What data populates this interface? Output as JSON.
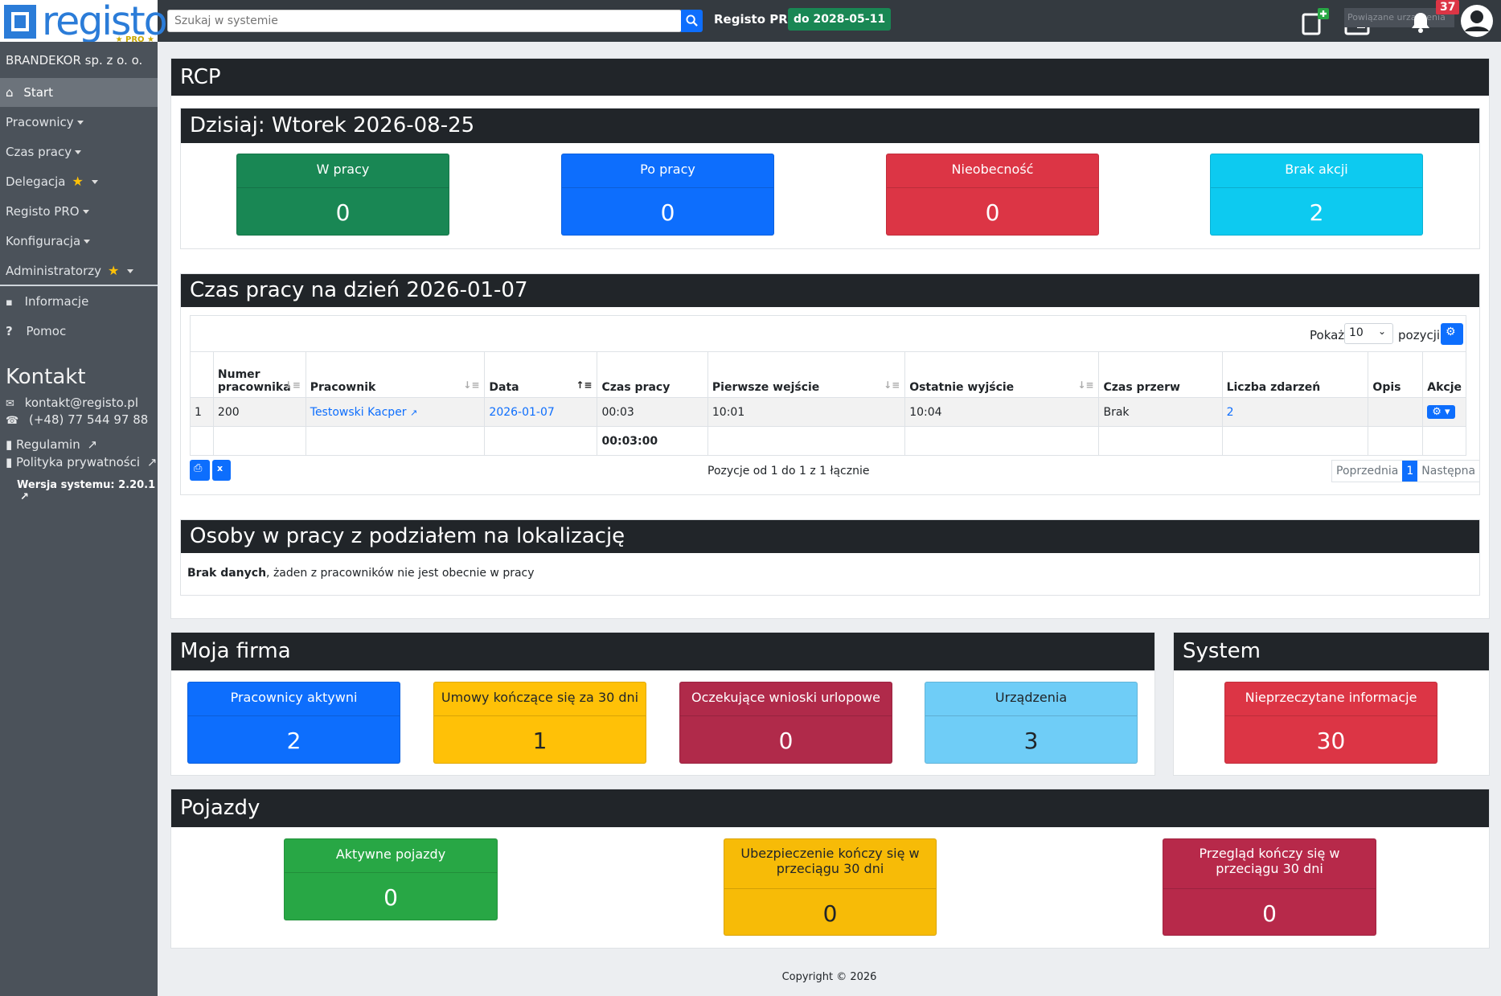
{
  "header": {
    "logo_text": "registo",
    "logo_pro": "★ PRO ★",
    "search_placeholder": "Szukaj w systemie",
    "pro_label": "Registo PRO",
    "pro_badge": "do 2028-05-11",
    "linked_devices_label": "Powiązane urządzenia",
    "notification_count": "37"
  },
  "sidebar": {
    "company": "BRANDEKOR sp. z o. o.",
    "items": [
      {
        "label": "Start"
      },
      {
        "label": "Pracownicy"
      },
      {
        "label": "Czas pracy"
      },
      {
        "label": "Delegacja"
      },
      {
        "label": "Registo PRO"
      },
      {
        "label": "Konfiguracja"
      },
      {
        "label": "Administratorzy"
      },
      {
        "label": "Informacje"
      },
      {
        "label": "Pomoc"
      }
    ],
    "kontakt_title": "Kontakt",
    "email": "kontakt@registo.pl",
    "phone": "(+48) 77 544 97 88",
    "regulamin": "Regulamin",
    "privacy": "Polityka prywatności",
    "version": "Wersja systemu: 2.20.1"
  },
  "rcp": {
    "title": "RCP",
    "today": {
      "title": "Dzisiaj: Wtorek 2026-08-25",
      "cards": [
        {
          "label": "W pracy",
          "value": "0"
        },
        {
          "label": "Po pracy",
          "value": "0"
        },
        {
          "label": "Nieobecność",
          "value": "0"
        },
        {
          "label": "Brak akcji",
          "value": "2"
        }
      ]
    },
    "worktime": {
      "title": "Czas pracy na dzień 2026-01-07",
      "show_label": "Pokaż",
      "show_value": "10",
      "show_suffix": "pozycji",
      "columns": [
        "",
        "Numer pracownika",
        "Pracownik",
        "Data",
        "Czas pracy",
        "Pierwsze wejście",
        "Ostatnie wyjście",
        "Czas przerw",
        "Liczba zdarzeń",
        "Opis",
        "Akcje"
      ],
      "rows": [
        {
          "lp": "1",
          "number": "200",
          "employee": "Testowski Kacper",
          "date": "2026-01-07",
          "time": "00:03",
          "first_in": "10:01",
          "last_out": "10:04",
          "breaks": "Brak",
          "events": "2",
          "desc": ""
        }
      ],
      "total": "00:03:00",
      "info": "Pozycje od 1 do 1 z 1 łącznie",
      "prev": "Poprzednia",
      "page": "1",
      "next": "Następna"
    },
    "locations": {
      "title": "Osoby w pracy z podziałem na lokalizację",
      "empty_bold": "Brak danych",
      "empty_text": ", żaden z pracowników nie jest obecnie w pracy"
    }
  },
  "firm": {
    "title": "Moja firma",
    "cards": [
      {
        "label": "Pracownicy aktywni",
        "value": "2"
      },
      {
        "label": "Umowy kończące się za 30 dni",
        "value": "1"
      },
      {
        "label": "Oczekujące wnioski urlopowe",
        "value": "0"
      },
      {
        "label": "Urządzenia",
        "value": "3"
      }
    ]
  },
  "system": {
    "title": "System",
    "cards": [
      {
        "label": "Nieprzeczytane informacje",
        "value": "30"
      }
    ]
  },
  "vehicles": {
    "title": "Pojazdy",
    "cards": [
      {
        "label": "Aktywne pojazdy",
        "value": "0"
      },
      {
        "label": "Ubezpieczenie kończy się w przeciągu 30 dni",
        "value": "0"
      },
      {
        "label": "Przegląd kończy się w przeciągu 30 dni",
        "value": "0"
      }
    ]
  },
  "footer": {
    "copyright": "Copyright © 2026"
  },
  "colors": {
    "primary": "#0d6efd",
    "success": "#198754",
    "danger": "#dc3545",
    "info": "#0dcaf0",
    "warning": "#ffc107",
    "dark": "#212529",
    "sidebar": "#4b525a"
  }
}
